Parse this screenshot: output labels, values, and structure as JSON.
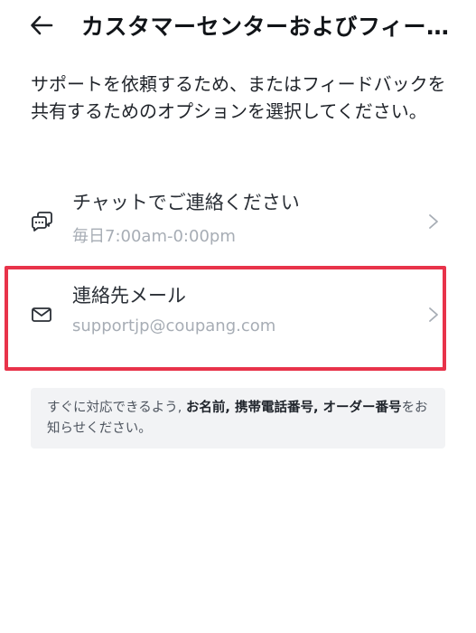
{
  "header": {
    "title": "カスタマーセンターおよびフィードバック"
  },
  "intro": "サポートを依頼するため、またはフィードバックを共有するためのオプションを選択してください。",
  "options": [
    {
      "title": "チャットでご連絡ください",
      "subtitle": "毎日7:00am-0:00pm",
      "icon": "chat-bubbles-icon"
    },
    {
      "title": "連絡先メール",
      "subtitle": "supportjp@coupang.com",
      "icon": "mail-icon",
      "highlighted": true
    }
  ],
  "notice": {
    "prefix": "すぐに対応できるよう, ",
    "bold": "お名前, 携帯電話番号, オーダー番号",
    "suffix": "をお知らせください。"
  },
  "colors": {
    "highlight_border": "#e8334a",
    "notice_background": "#f2f3f5",
    "subtitle_text": "#a7adb5"
  }
}
